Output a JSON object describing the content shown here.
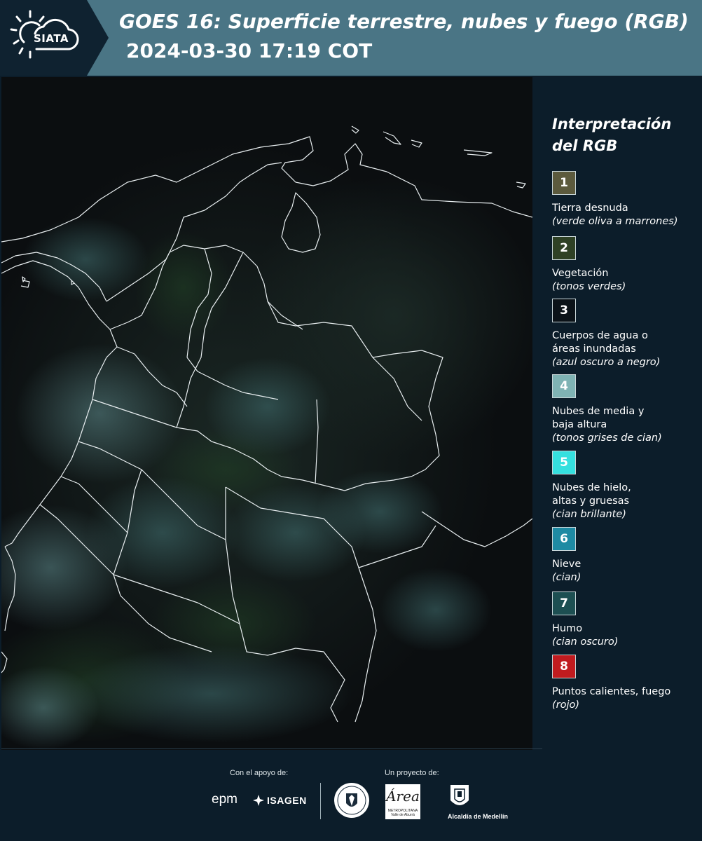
{
  "header": {
    "logo_text": "SIATA",
    "title": "GOES 16: Superficie terrestre, nubes y fuego (RGB)",
    "timestamp": "2024-03-30 17:19 COT"
  },
  "legend": {
    "title_line1": "Interpretación",
    "title_line2": "del RGB",
    "items": [
      {
        "number": "1",
        "color": "#5c5a3d",
        "label_line1": "Tierra desnuda",
        "label_line2": "",
        "note": "(verde oliva a marrones)"
      },
      {
        "number": "2",
        "color": "#2f4125",
        "label_line1": "Vegetación",
        "label_line2": "",
        "note": "(tonos verdes)"
      },
      {
        "number": "3",
        "color": "#0b1218",
        "label_line1": "Cuerpos de agua o",
        "label_line2": "áreas inundadas",
        "note": "(azul oscuro a negro)"
      },
      {
        "number": "4",
        "color": "#7fb3b4",
        "label_line1": "Nubes de media y",
        "label_line2": "baja altura",
        "note": "(tonos grises de cian)"
      },
      {
        "number": "5",
        "color": "#35e0df",
        "label_line1": "Nubes de hielo,",
        "label_line2": "altas y gruesas",
        "note": "(cian brillante)"
      },
      {
        "number": "6",
        "color": "#1e8aa3",
        "label_line1": "Nieve",
        "label_line2": "",
        "note": "(cian)"
      },
      {
        "number": "7",
        "color": "#1d4f52",
        "label_line1": "Humo",
        "label_line2": "",
        "note": "(cian oscuro)"
      },
      {
        "number": "8",
        "color": "#c01b1f",
        "label_line1": "Puntos calientes, fuego",
        "label_line2": "",
        "note": "(rojo)"
      }
    ]
  },
  "footer": {
    "support_label": "Con el apoyo de:",
    "project_label": "Un proyecto de:",
    "sponsor1": "epm",
    "sponsor2": "ISAGEN",
    "partner_area": "Área",
    "partner_area_small": "METROPOLITANA Valle de Aburrá",
    "partner_medellin": "Alcaldía de Medellín"
  }
}
